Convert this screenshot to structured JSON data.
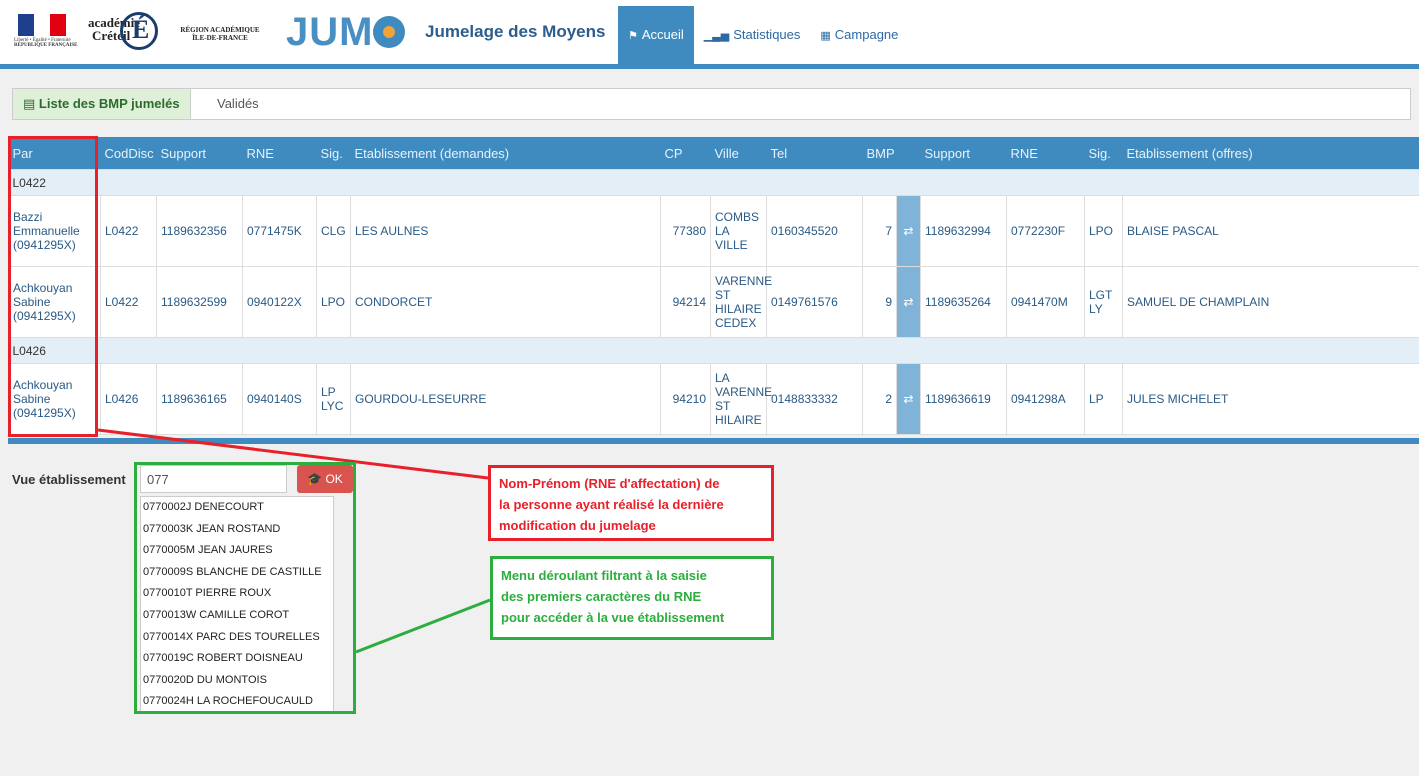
{
  "header": {
    "logo_rf_text": "Liberté • Égalité • Fraternité",
    "logo_rf_title": "RÉPUBLIQUE FRANÇAISE",
    "logo_academie_1": "académie",
    "logo_academie_2": "Créteil",
    "logo_academie_letter": "É",
    "logo_region_1": "RÉGION ACADÉMIQUE",
    "logo_region_2": "ÎLE-DE-FRANCE",
    "logo_jumo": "JUM",
    "app_title": "Jumelage des Moyens",
    "nav": [
      {
        "label": "Accueil",
        "icon": "flag-icon"
      },
      {
        "label": "Statistiques",
        "icon": "bar-chart-icon"
      },
      {
        "label": "Campagne",
        "icon": "calendar-icon"
      }
    ]
  },
  "subtabs": {
    "active": "Liste des BMP jumelés",
    "second": "Validés"
  },
  "table": {
    "columns": [
      "Par",
      "CodDisc",
      "Support",
      "RNE",
      "Sig.",
      "Etablissement (demandes)",
      "CP",
      "Ville",
      "Tel",
      "BMP",
      "",
      "Support",
      "RNE",
      "Sig.",
      "Etablissement (offres)"
    ],
    "groups": [
      {
        "code": "L0422",
        "rows": [
          {
            "par": [
              "Bazzi",
              "Emmanuelle",
              "(0941295X)"
            ],
            "coddisc": "L0422",
            "support": "1189632356",
            "rne": "0771475K",
            "sig": "CLG",
            "etab": "LES AULNES",
            "cp": "77380",
            "ville": [
              "COMBS",
              "LA VILLE"
            ],
            "tel": "0160345520",
            "bmp": "7",
            "support2": "1189632994",
            "rne2": "0772230F",
            "sig2": "LPO",
            "etab2": "BLAISE PASCAL"
          },
          {
            "par": [
              "Achkouyan",
              "Sabine",
              "(0941295X)"
            ],
            "coddisc": "L0422",
            "support": "1189632599",
            "rne": "0940122X",
            "sig": "LPO",
            "etab": "CONDORCET",
            "cp": "94214",
            "ville": [
              "VARENNE",
              "ST",
              "HILAIRE",
              "CEDEX"
            ],
            "tel": "0149761576",
            "bmp": "9",
            "support2": "1189635264",
            "rne2": "0941470M",
            "sig2": "LGT LY",
            "etab2": "SAMUEL DE CHAMPLAIN"
          }
        ]
      },
      {
        "code": "L0426",
        "rows": [
          {
            "par": [
              "Achkouyan",
              "Sabine",
              "(0941295X)"
            ],
            "coddisc": "L0426",
            "support": "1189636165",
            "rne": "0940140S",
            "sig": "LP LYC",
            "etab": "GOURDOU-LESEURRE",
            "cp": "94210",
            "ville": [
              "LA",
              "VARENNE",
              "ST",
              "HILAIRE"
            ],
            "tel": "0148833332",
            "bmp": "2",
            "support2": "1189636619",
            "rne2": "0941298A",
            "sig2": "LP",
            "etab2": "JULES MICHELET"
          }
        ]
      }
    ],
    "swap_icon": "⇄"
  },
  "vue": {
    "label": "Vue établissement",
    "input_value": "077",
    "ok_label": "OK",
    "options": [
      "0770002J DENECOURT",
      "0770003K JEAN ROSTAND",
      "0770005M JEAN JAURES",
      "0770009S BLANCHE DE CASTILLE",
      "0770010T PIERRE ROUX",
      "0770013W CAMILLE COROT",
      "0770014X PARC DES TOURELLES",
      "0770019C ROBERT DOISNEAU",
      "0770020D DU MONTOIS",
      "0770024H LA ROCHEFOUCAULD"
    ]
  },
  "annotations": {
    "red_note": [
      "Nom-Prénom (RNE d'affectation) de",
      "la personne ayant réalisé la dernière",
      "modification du jumelage"
    ],
    "green_note": [
      "Menu déroulant filtrant à la saisie",
      "des premiers caractères du RNE",
      "pour accéder à la vue établissement"
    ],
    "red_color": "#e8202a",
    "green_color": "#2bae3d"
  },
  "colors": {
    "accent": "#3f8bbf"
  }
}
